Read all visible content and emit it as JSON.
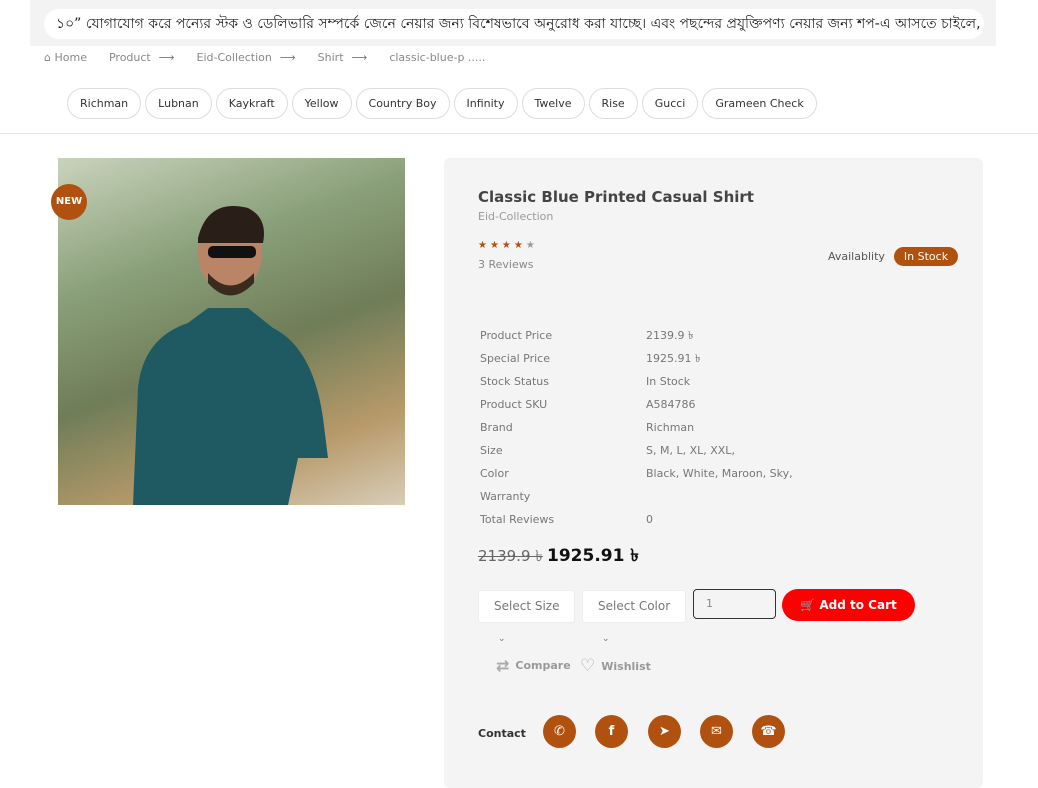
{
  "ticker": {
    "text": "১০” যোগাযোগ করে পন্যের স্টক ও ডেলিভারি সম্পর্কে জেনে নেয়ার জন্য বিশেষভাবে অনুরোধ করা যাচ্ছে। এবং পছন্দের প্রযুক্তিপণ্য নেয়ার জন্য শপ-এ আসতে চাইলে, আজই চলে"
  },
  "breadcrumb": {
    "home": "Home",
    "items": [
      "Product",
      "Eid-Collection",
      "Shirt"
    ],
    "current": "classic-blue-p .....",
    "separator": "⟶"
  },
  "brands": [
    "Richman",
    "Lubnan",
    "Kaykraft",
    "Yellow",
    "Country Boy",
    "Infinity",
    "Twelve",
    "Rise",
    "Gucci",
    "Grameen Check"
  ],
  "product": {
    "badge": "NEW",
    "title": "Classic Blue Printed Casual Shirt",
    "collection": "Eid-Collection",
    "rating": 4,
    "rating_max": 5,
    "reviews": "3 Reviews",
    "availability_label": "Availablity",
    "availability": "In Stock",
    "specs": [
      {
        "k": "Product Price",
        "v": "2139.9 ৳"
      },
      {
        "k": "Special Price",
        "v": "1925.91 ৳"
      },
      {
        "k": "Stock Status",
        "v": "In Stock"
      },
      {
        "k": "Product SKU",
        "v": "A584786"
      },
      {
        "k": "Brand",
        "v": "Richman"
      },
      {
        "k": "Size",
        "v": "S, M, L, XL, XXL,"
      },
      {
        "k": "Color",
        "v": "Black, White, Maroon, Sky,"
      },
      {
        "k": "Warranty",
        "v": ""
      },
      {
        "k": "Total Reviews",
        "v": "0"
      }
    ],
    "old_price": "2139.9 ৳",
    "new_price": "1925.91 ৳",
    "size_select": "Select Size",
    "color_select": "Select Color",
    "quantity": "1",
    "add_to_cart": "Add to Cart",
    "compare": "Compare",
    "wishlist": "Wishlist",
    "contact_label": "Contact",
    "contacts": [
      "whatsapp-icon",
      "facebook-icon",
      "telegram-icon",
      "email-icon",
      "phone-icon"
    ]
  },
  "colors": {
    "accent": "#b0510f",
    "cart": "#ff0000"
  }
}
